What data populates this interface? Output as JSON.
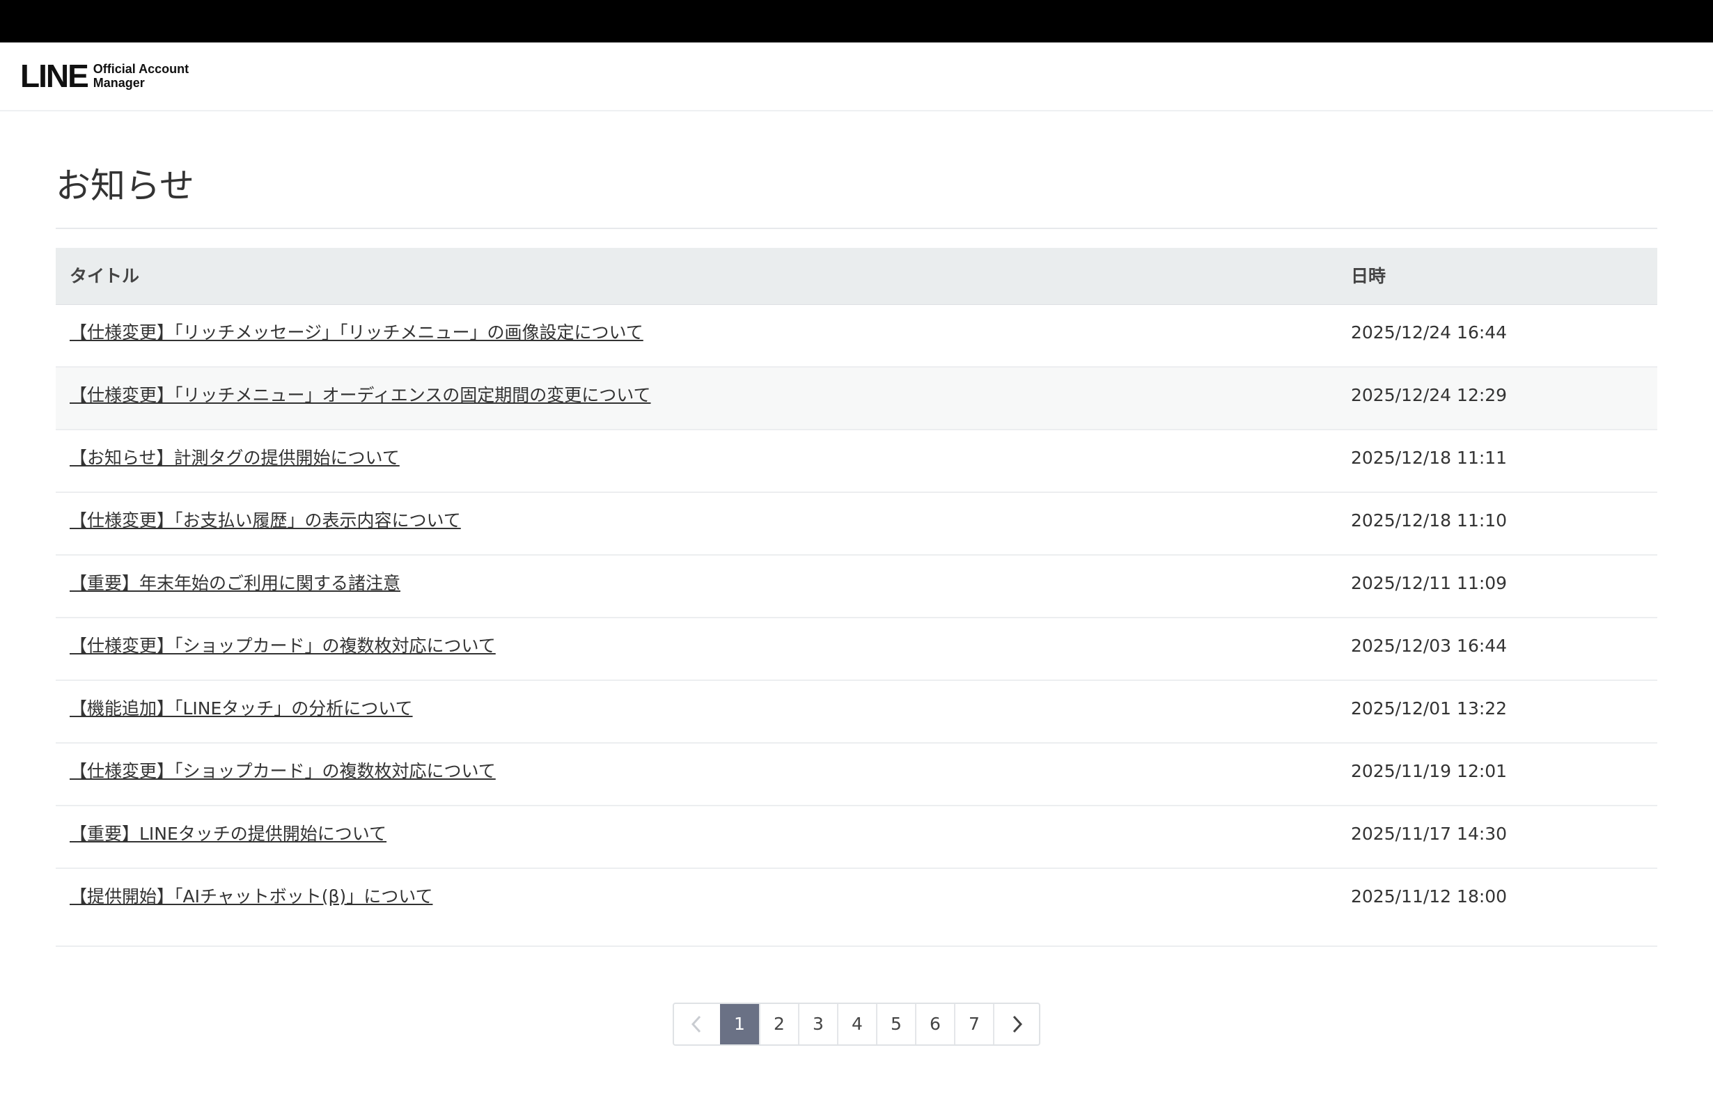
{
  "header": {
    "logo_main": "LINE",
    "logo_sub_line1": "Official Account",
    "logo_sub_line2": "Manager"
  },
  "page": {
    "title": "お知らせ"
  },
  "table": {
    "columns": {
      "title": "タイトル",
      "date": "日時"
    },
    "rows": [
      {
        "title": "【仕様変更】「リッチメッセージ」「リッチメニュー」の画像設定について",
        "date": "2025/12/24 16:44"
      },
      {
        "title": "【仕様変更】「リッチメニュー」オーディエンスの固定期間の変更について",
        "date": "2025/12/24 12:29"
      },
      {
        "title": "【お知らせ】計測タグの提供開始について",
        "date": "2025/12/18 11:11"
      },
      {
        "title": "【仕様変更】「お支払い履歴」の表示内容について",
        "date": "2025/12/18 11:10"
      },
      {
        "title": "【重要】年末年始のご利用に関する諸注意",
        "date": "2025/12/11 11:09"
      },
      {
        "title": "【仕様変更】「ショップカード」の複数枚対応について",
        "date": "2025/12/03 16:44"
      },
      {
        "title": "【機能追加】「LINEタッチ」の分析について",
        "date": "2025/12/01 13:22"
      },
      {
        "title": "【仕様変更】「ショップカード」の複数枚対応について",
        "date": "2025/11/19 12:01"
      },
      {
        "title": "【重要】LINEタッチの提供開始について",
        "date": "2025/11/17 14:30"
      },
      {
        "title": "【提供開始】「AIチャットボット(β)」について",
        "date": "2025/11/12 18:00"
      }
    ]
  },
  "pagination": {
    "pages": [
      "1",
      "2",
      "3",
      "4",
      "5",
      "6",
      "7"
    ],
    "current": "1",
    "prev_icon": "chevron-left-icon",
    "next_icon": "chevron-right-icon"
  }
}
